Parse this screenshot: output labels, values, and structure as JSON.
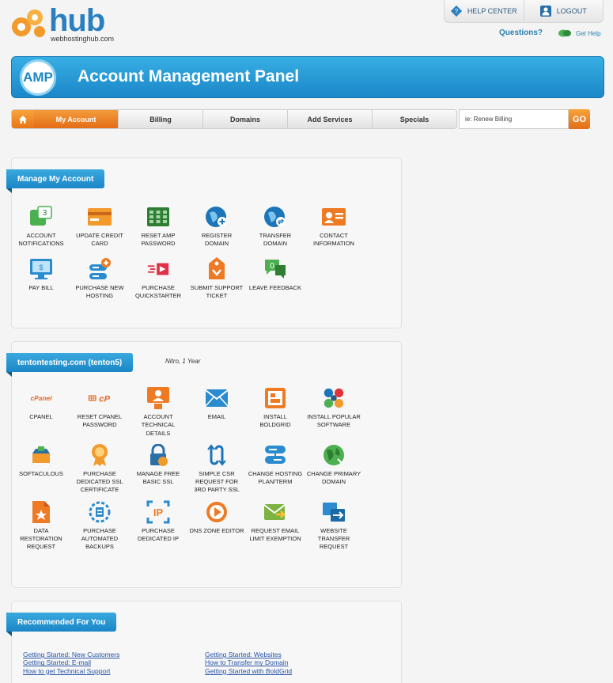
{
  "header": {
    "logo_word": "hub",
    "logo_sub": "webhostinghub.com",
    "help_center": "HELP CENTER",
    "logout": "LOGOUT",
    "questions": "Questions?",
    "get_help": "Get Help"
  },
  "banner": {
    "badge": "AMP",
    "title": "Account Management Panel"
  },
  "nav": {
    "items": [
      "My Account",
      "Billing",
      "Domains",
      "Add Services",
      "Specials"
    ],
    "search_value": "ie: Renew Billing",
    "go": "GO"
  },
  "manage": {
    "title": "Manage My Account",
    "notification_count": "3",
    "tiles": [
      {
        "label": "ACCOUNT NOTIFICATIONS",
        "icon": "notifications-icon"
      },
      {
        "label": "UPDATE CREDIT CARD",
        "icon": "credit-card-icon"
      },
      {
        "label": "RESET AMP PASSWORD",
        "icon": "password-keypad-icon"
      },
      {
        "label": "REGISTER DOMAIN",
        "icon": "globe-plus-icon"
      },
      {
        "label": "TRANSFER DOMAIN",
        "icon": "globe-transfer-icon"
      },
      {
        "label": "CONTACT INFORMATION",
        "icon": "contact-card-icon"
      },
      {
        "label": "PAY BILL",
        "icon": "monitor-pay-icon"
      },
      {
        "label": "PURCHASE NEW HOSTING",
        "icon": "server-plus-icon"
      },
      {
        "label": "PURCHASE QUICKSTARTER",
        "icon": "quickstarter-icon"
      },
      {
        "label": "SUBMIT SUPPORT TICKET",
        "icon": "ticket-icon"
      },
      {
        "label": "LEAVE FEEDBACK",
        "icon": "feedback-bubble-icon"
      }
    ],
    "feedback_count": "0"
  },
  "hosting": {
    "title": "tentontesting.com (tenton5)",
    "plan": "Nitro, 1 Year",
    "tiles": [
      {
        "label": "CPANEL",
        "icon": "cpanel-logo-icon"
      },
      {
        "label": "RESET CPANEL PASSWORD",
        "icon": "cpanel-reset-icon"
      },
      {
        "label": "ACCOUNT TECHNICAL DETAILS",
        "icon": "technical-details-icon"
      },
      {
        "label": "EMAIL",
        "icon": "envelope-icon"
      },
      {
        "label": "INSTALL BOLDGRID",
        "icon": "boldgrid-icon"
      },
      {
        "label": "INSTALL POPULAR SOFTWARE",
        "icon": "software-blocks-icon"
      },
      {
        "label": "SOFTACULOUS",
        "icon": "softaculous-icon"
      },
      {
        "label": "PURCHASE DEDICATED SSL CERTIFICATE",
        "icon": "ssl-ribbon-icon"
      },
      {
        "label": "MANAGE FREE BASIC SSL",
        "icon": "lock-icon"
      },
      {
        "label": "SIMPLE CSR REQUEST FOR 3RD PARTY SSL",
        "icon": "csr-request-icon"
      },
      {
        "label": "CHANGE HOSTING PLAN/TERM",
        "icon": "server-change-icon"
      },
      {
        "label": "CHANGE PRIMARY DOMAIN",
        "icon": "globe-change-icon"
      },
      {
        "label": "DATA RESTORATION REQUEST",
        "icon": "restore-file-icon"
      },
      {
        "label": "PURCHASE AUTOMATED BACKUPS",
        "icon": "backup-icon"
      },
      {
        "label": "PURCHASE DEDICATED IP",
        "icon": "dedicated-ip-icon"
      },
      {
        "label": "DNS ZONE EDITOR",
        "icon": "dns-editor-icon"
      },
      {
        "label": "REQUEST EMAIL LIMIT EXEMPTION",
        "icon": "email-exemption-icon"
      },
      {
        "label": "WEBSITE TRANSFER REQUEST",
        "icon": "website-transfer-icon"
      }
    ],
    "cpanel_text": "cPanel",
    "ip_text": "IP"
  },
  "recommended": {
    "title": "Recommended For You",
    "left_links": [
      "Getting Started: New Customers",
      "Getting Started: E-mail",
      "How to get Technical Support"
    ],
    "right_links": [
      "Getting Started: Websites",
      "How to Transfer my Domain",
      "Getting Started with BoldGrid"
    ]
  },
  "colors": {
    "brand_blue": "#1b86c6",
    "accent_orange": "#e8751a",
    "icon_green": "#4caf50",
    "icon_red": "#e0533a"
  }
}
